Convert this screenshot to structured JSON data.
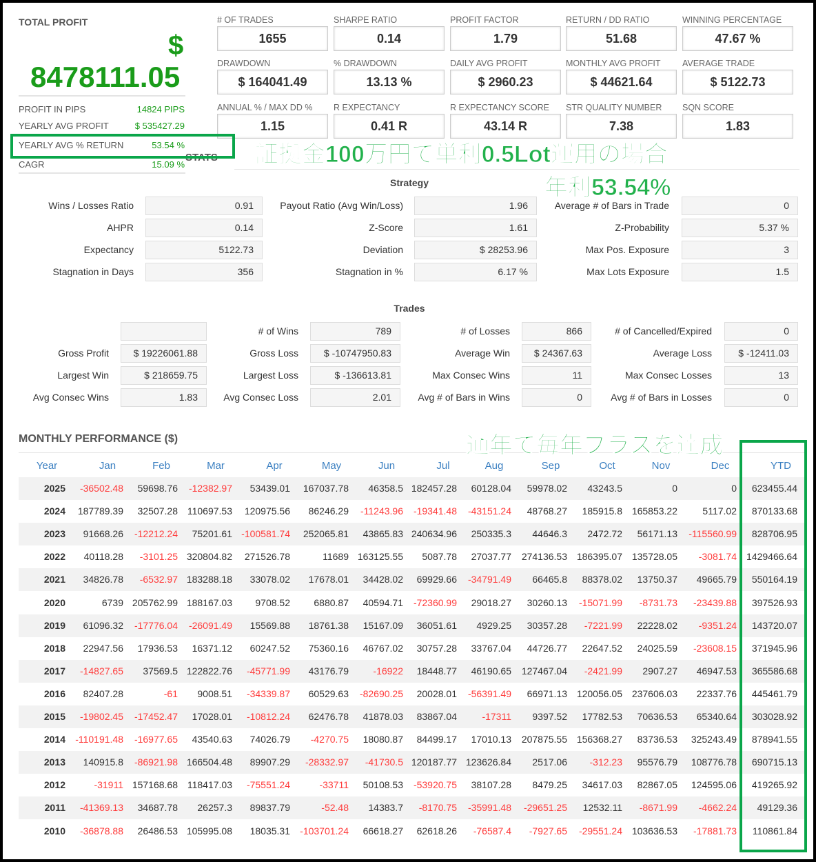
{
  "total_profit": {
    "label": "TOTAL PROFIT",
    "currency": "$",
    "value": "8478111.05"
  },
  "left_stats": [
    {
      "label": "PROFIT IN PIPS",
      "value": "14824 PIPS"
    },
    {
      "label": "YEARLY AVG PROFIT",
      "value": "$ 535427.29"
    },
    {
      "label": "YEARLY AVG % RETURN",
      "value": "53.54 %"
    },
    {
      "label": "CAGR",
      "value": "15.09 %"
    }
  ],
  "stats_overlap_label": "STATS",
  "stat_boxes": [
    {
      "label": "# OF TRADES",
      "value": "1655"
    },
    {
      "label": "SHARPE RATIO",
      "value": "0.14"
    },
    {
      "label": "PROFIT FACTOR",
      "value": "1.79"
    },
    {
      "label": "RETURN / DD RATIO",
      "value": "51.68"
    },
    {
      "label": "WINNING PERCENTAGE",
      "value": "47.67 %"
    },
    {
      "label": "DRAWDOWN",
      "value": "$ 164041.49"
    },
    {
      "label": "% DRAWDOWN",
      "value": "13.13 %"
    },
    {
      "label": "DAILY AVG PROFIT",
      "value": "$ 2960.23"
    },
    {
      "label": "MONTHLY AVG PROFIT",
      "value": "$ 44621.64"
    },
    {
      "label": "AVERAGE TRADE",
      "value": "$ 5122.73"
    },
    {
      "label": "ANNUAL % / MAX DD %",
      "value": "1.15"
    },
    {
      "label": "R EXPECTANCY",
      "value": "0.41 R"
    },
    {
      "label": "R EXPECTANCY SCORE",
      "value": "43.14 R"
    },
    {
      "label": "STR QUALITY NUMBER",
      "value": "7.38"
    },
    {
      "label": "SQN SCORE",
      "value": "1.83"
    }
  ],
  "strategy": {
    "title": "Strategy",
    "rows": [
      [
        [
          "Wins / Losses Ratio",
          "0.91"
        ],
        [
          "Payout Ratio (Avg Win/Loss)",
          "1.96"
        ],
        [
          "Average # of Bars in Trade",
          "0"
        ]
      ],
      [
        [
          "AHPR",
          "0.14"
        ],
        [
          "Z-Score",
          "1.61"
        ],
        [
          "Z-Probability",
          "5.37 %"
        ]
      ],
      [
        [
          "Expectancy",
          "5122.73"
        ],
        [
          "Deviation",
          "$ 28253.96"
        ],
        [
          "Max Pos. Exposure",
          "3"
        ]
      ],
      [
        [
          "Stagnation in Days",
          "356"
        ],
        [
          "Stagnation in %",
          "6.17 %"
        ],
        [
          "Max Lots Exposure",
          "1.5"
        ]
      ]
    ]
  },
  "trades": {
    "title": "Trades",
    "rows": [
      [
        [
          "",
          ""
        ],
        [
          "# of Wins",
          "789"
        ],
        [
          "# of Losses",
          "866"
        ],
        [
          "# of Cancelled/Expired",
          "0"
        ]
      ],
      [
        [
          "Gross Profit",
          "$ 19226061.88"
        ],
        [
          "Gross Loss",
          "$ -10747950.83"
        ],
        [
          "Average Win",
          "$ 24367.63"
        ],
        [
          "Average Loss",
          "$ -12411.03"
        ]
      ],
      [
        [
          "Largest Win",
          "$ 218659.75"
        ],
        [
          "Largest Loss",
          "$ -136613.81"
        ],
        [
          "Max Consec Wins",
          "11"
        ],
        [
          "Max Consec Losses",
          "13"
        ]
      ],
      [
        [
          "Avg Consec Wins",
          "1.83"
        ],
        [
          "Avg Consec Loss",
          "2.01"
        ],
        [
          "Avg # of Bars in Wins",
          "0"
        ],
        [
          "Avg # of Bars in Losses",
          "0"
        ]
      ]
    ]
  },
  "monthly": {
    "title": "MONTHLY PERFORMANCE ($)",
    "headers": [
      "Year",
      "Jan",
      "Feb",
      "Mar",
      "Apr",
      "May",
      "Jun",
      "Jul",
      "Aug",
      "Sep",
      "Oct",
      "Nov",
      "Dec",
      "YTD"
    ],
    "rows": [
      [
        "2025",
        "-36502.48",
        "59698.76",
        "-12382.97",
        "53439.01",
        "167037.78",
        "46358.5",
        "182457.28",
        "60128.04",
        "59978.02",
        "43243.5",
        "0",
        "0",
        "623455.44"
      ],
      [
        "2024",
        "187789.39",
        "32507.28",
        "110697.53",
        "120975.56",
        "86246.29",
        "-11243.96",
        "-19341.48",
        "-43151.24",
        "48768.27",
        "185915.8",
        "165853.22",
        "5117.02",
        "870133.68"
      ],
      [
        "2023",
        "91668.26",
        "-12212.24",
        "75201.61",
        "-100581.74",
        "252065.81",
        "43865.83",
        "240634.96",
        "250335.3",
        "44646.3",
        "2472.72",
        "56171.13",
        "-115560.99",
        "828706.95"
      ],
      [
        "2022",
        "40118.28",
        "-3101.25",
        "320804.82",
        "271526.78",
        "11689",
        "163125.55",
        "5087.78",
        "27037.77",
        "274136.53",
        "186395.07",
        "135728.05",
        "-3081.74",
        "1429466.64"
      ],
      [
        "2021",
        "34826.78",
        "-6532.97",
        "183288.18",
        "33078.02",
        "17678.01",
        "34428.02",
        "69929.66",
        "-34791.49",
        "66465.8",
        "88378.02",
        "13750.37",
        "49665.79",
        "550164.19"
      ],
      [
        "2020",
        "6739",
        "205762.99",
        "188167.03",
        "9708.52",
        "6880.87",
        "40594.71",
        "-72360.99",
        "29018.27",
        "30260.13",
        "-15071.99",
        "-8731.73",
        "-23439.88",
        "397526.93"
      ],
      [
        "2019",
        "61096.32",
        "-17776.04",
        "-26091.49",
        "15569.88",
        "18761.38",
        "15167.09",
        "36051.61",
        "4929.25",
        "30357.28",
        "-7221.99",
        "22228.02",
        "-9351.24",
        "143720.07"
      ],
      [
        "2018",
        "22947.56",
        "17936.53",
        "16371.12",
        "60247.52",
        "75360.16",
        "46767.02",
        "30757.28",
        "33767.04",
        "44726.77",
        "22647.52",
        "24025.59",
        "-23608.15",
        "371945.96"
      ],
      [
        "2017",
        "-14827.65",
        "37569.5",
        "122822.76",
        "-45771.99",
        "43176.79",
        "-16922",
        "18448.77",
        "46190.65",
        "127467.04",
        "-2421.99",
        "2907.27",
        "46947.53",
        "365586.68"
      ],
      [
        "2016",
        "82407.28",
        "-61",
        "9008.51",
        "-34339.87",
        "60529.63",
        "-82690.25",
        "20028.01",
        "-56391.49",
        "66971.13",
        "120056.05",
        "237606.03",
        "22337.76",
        "445461.79"
      ],
      [
        "2015",
        "-19802.45",
        "-17452.47",
        "17028.01",
        "-10812.24",
        "62476.78",
        "41878.03",
        "83867.04",
        "-17311",
        "9397.52",
        "17782.53",
        "70636.53",
        "65340.64",
        "303028.92"
      ],
      [
        "2014",
        "-110191.48",
        "-16977.65",
        "43540.63",
        "74026.79",
        "-4270.75",
        "18080.87",
        "84499.17",
        "17010.13",
        "207875.55",
        "156368.27",
        "83736.53",
        "325243.49",
        "878941.55"
      ],
      [
        "2013",
        "140915.8",
        "-86921.98",
        "166504.48",
        "89907.29",
        "-28332.97",
        "-41730.5",
        "120187.77",
        "123626.84",
        "2517.06",
        "-312.23",
        "95576.79",
        "108776.78",
        "690715.13"
      ],
      [
        "2012",
        "-31911",
        "157168.68",
        "118417.03",
        "-75551.24",
        "-33711",
        "50108.53",
        "-53920.75",
        "38107.28",
        "8479.25",
        "34617.03",
        "82867.05",
        "124595.06",
        "419265.92"
      ],
      [
        "2011",
        "-41369.13",
        "34687.78",
        "26257.3",
        "89837.79",
        "-52.48",
        "14383.7",
        "-8170.75",
        "-35991.48",
        "-29651.25",
        "12532.11",
        "-8671.99",
        "-4662.24",
        "49129.36"
      ],
      [
        "2010",
        "-36878.88",
        "26486.53",
        "105995.08",
        "18035.31",
        "-103701.24",
        "66618.27",
        "62618.26",
        "-76587.4",
        "-7927.65",
        "-29551.24",
        "103636.53",
        "-17881.73",
        "110861.84"
      ]
    ]
  },
  "annotations": {
    "line1": "証拠金100万円で単利0.5Lot運用の場合",
    "line2": "年利53.54%",
    "line3": "通年で毎年プラスを達成"
  },
  "colors": {
    "positive": "#1a9c1a",
    "negative": "#ff3b3b",
    "header": "#3a7fc1",
    "annotation": "#22b14c"
  }
}
